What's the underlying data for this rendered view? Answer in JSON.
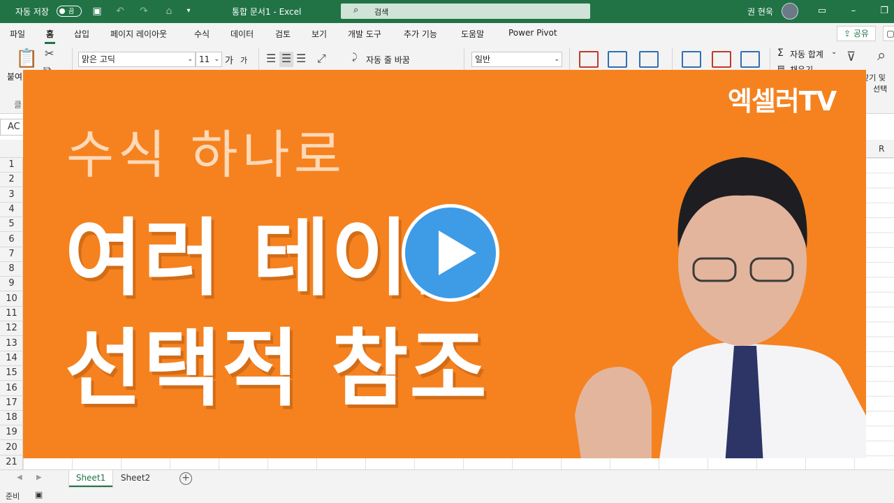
{
  "app": {
    "autosave_label": "자동 저장",
    "autosave_state": "끔",
    "doc_title": "통합 문서1  -  Excel",
    "search_placeholder": "검색",
    "user_name": "권 현욱",
    "accent_color": "#217346"
  },
  "ribbon_tabs": [
    "파일",
    "홈",
    "삽입",
    "페이지 레이아웃",
    "수식",
    "데이터",
    "검토",
    "보기",
    "개발 도구",
    "추가 기능",
    "도움말",
    "Power Pivot"
  ],
  "share_label": "공유",
  "ribbon": {
    "paste_label": "붙여",
    "font_name": "맑은 고딕",
    "font_size": "11",
    "grow_font": "가",
    "shrink_font": "가",
    "wrap_text": "자동 줄 바꿈",
    "number_format": "일반",
    "autosum": "자동 합계",
    "fill": "채우기",
    "find_select": "찾기 및",
    "select": "선택",
    "clipboard_group_fragment": "클"
  },
  "namebox": "AC",
  "column_visible": "R",
  "rows": [
    "1",
    "2",
    "3",
    "4",
    "5",
    "6",
    "7",
    "8",
    "9",
    "10",
    "11",
    "12",
    "13",
    "14",
    "15",
    "16",
    "17",
    "18",
    "19",
    "20",
    "21"
  ],
  "sheets": [
    "Sheet1",
    "Sheet2"
  ],
  "status": {
    "ready": "준비"
  },
  "thumbnail": {
    "brand": "엑셀러TV",
    "line1": "수식 하나로",
    "line2": "여러 테이블",
    "line3": "선택적 참조",
    "bg_color": "#f5821f",
    "play_color": "#3e9be6"
  }
}
